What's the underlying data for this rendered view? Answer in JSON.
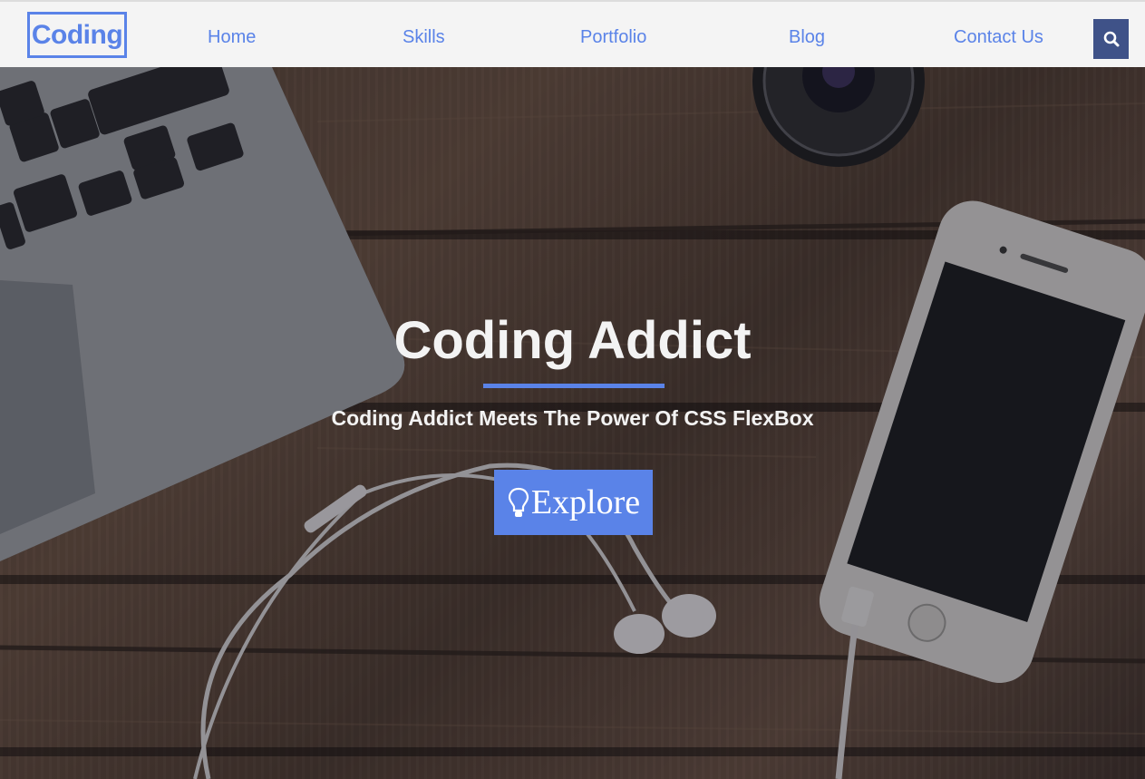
{
  "navbar": {
    "brand": "Coding",
    "links": [
      "Home",
      "Skills",
      "Portfolio",
      "Blog",
      "Contact Us"
    ],
    "search_icon": "search-icon"
  },
  "hero": {
    "title": "Coding Addict",
    "subtitle": "Coding Addict Meets The Power Of CSS FlexBox",
    "button_label": "Explore",
    "button_icon": "lightbulb-icon",
    "background": "wooden desk photo with laptop, camera lens, smartphone and earphones"
  },
  "colors": {
    "accent": "#5a83e8",
    "search_bg": "#3f5288",
    "navbar_bg": "#f4f4f4",
    "hero_text": "#f3f3f3"
  }
}
